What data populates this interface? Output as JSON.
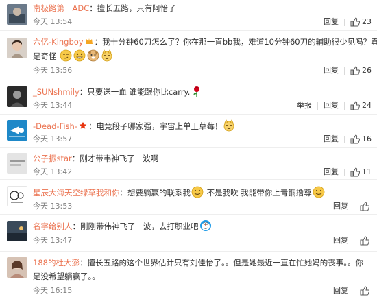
{
  "actions": {
    "report": "举报",
    "reply": "回复"
  },
  "comments": [
    {
      "user": "南极路第一ADC",
      "text": "：擅长五路，只有阿怡了",
      "time": "今天 13:54",
      "likes": "23",
      "report": false
    },
    {
      "user": "六亿-Kingboy",
      "text": "：我十分钟60刀怎么了？你在那一直bb我，难道10分钟60刀的辅助很少见吗？真",
      "text2": "是奇怪",
      "time": "今天 13:56",
      "likes": "26",
      "report": false
    },
    {
      "user": "_SUNshmily",
      "text": "：只要送一血  谁能跟你比carry.",
      "time": "今天 13:44",
      "likes": "24",
      "report": true
    },
    {
      "user": "-Dead-Fish-",
      "text": "：电竞段子哪家强，宇宙上单王草莓！",
      "time": "今天 13:57",
      "likes": "16",
      "report": false
    },
    {
      "user": "公子振star",
      "text": "：刚才带韦神飞了一波啊",
      "time": "今天 13:42",
      "likes": "11",
      "report": false
    },
    {
      "user": "星辰大海天空绿草我和你",
      "text": "：想要躺赢的联系我",
      "text_mid": " 不是我吹 我能带你上青铜撸尊",
      "time": "今天 13:53",
      "likes": "",
      "report": false
    },
    {
      "user": "名字给别人",
      "text": "：刚刚带伟神飞了一波，去打职业吧",
      "time": "今天 13:47",
      "likes": "",
      "report": false
    },
    {
      "user": "188的杜大澎",
      "text": "：擅长五路的这个世界估计只有刘佳怡了。。但是她最近一直在忙她妈的丧事。。你",
      "text2": "是没希望躺赢了。。",
      "time": "今天 16:15",
      "likes": "",
      "report": false
    }
  ],
  "colors": {
    "username": "#eb7350",
    "meta": "#808080",
    "divider": "#eeeeee"
  }
}
